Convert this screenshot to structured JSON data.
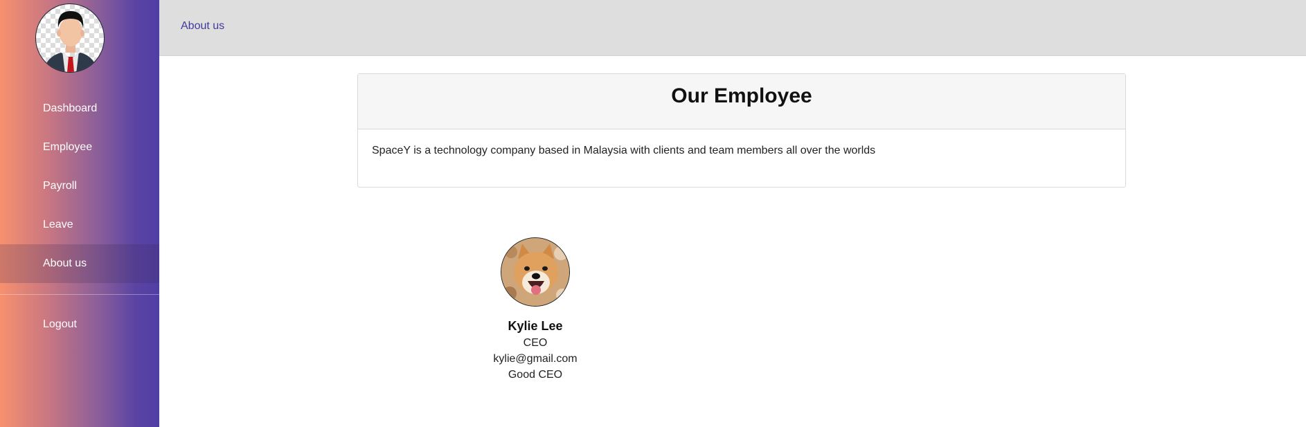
{
  "sidebar": {
    "items": [
      {
        "label": "Dashboard"
      },
      {
        "label": "Employee"
      },
      {
        "label": "Payroll"
      },
      {
        "label": "Leave"
      },
      {
        "label": "About us"
      }
    ],
    "logout_label": "Logout",
    "active_item": "About us"
  },
  "topbar": {
    "breadcrumb": "About us"
  },
  "card": {
    "title": "Our Employee",
    "description": "SpaceY is a technology company based in Malaysia with clients and team members all over the worlds"
  },
  "employees": [
    {
      "name": "Kylie Lee",
      "position": "CEO",
      "email": "kylie@gmail.com",
      "note": "Good CEO"
    }
  ],
  "colors": {
    "sidebar_gradient_start": "#f7906f",
    "sidebar_gradient_end": "#4f3ea6",
    "link": "#3f3b9c",
    "topbar": "#dedede"
  }
}
